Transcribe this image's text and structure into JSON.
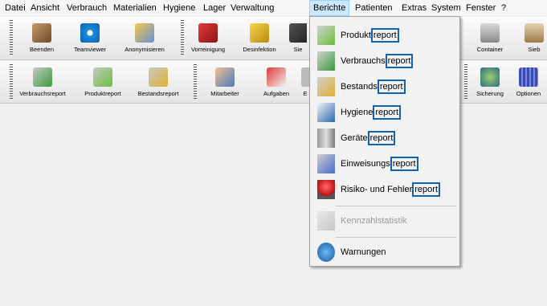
{
  "menubar": [
    "Datei",
    "Ansicht",
    "Verbrauch",
    "Materialien",
    "Hygiene",
    "Lager",
    "Verwaltung",
    "Berichte",
    "Patienten",
    "Extras",
    "System",
    "Fenster",
    "?"
  ],
  "toolbar1": [
    "Beenden",
    "Teamviewer",
    "Anonymisieren",
    "Vorreinigung",
    "Desinfektion",
    "Sie",
    "Container",
    "Sieb"
  ],
  "toolbar2": [
    "Verbrauchsreport",
    "Produktreport",
    "Bestandsreport",
    "Mitarbeiter",
    "Aufgaben",
    "E",
    "Sicherung",
    "Optionen"
  ],
  "berichte_menu": [
    {
      "prefix": "Produkt",
      "highlight": "report",
      "icon": "product-report-icon"
    },
    {
      "prefix": "Verbrauchs",
      "highlight": "report",
      "icon": "usage-report-icon"
    },
    {
      "prefix": "Bestands",
      "highlight": "report",
      "icon": "stock-report-icon"
    },
    {
      "prefix": "Hygiene",
      "highlight": "report",
      "icon": "hygiene-report-icon"
    },
    {
      "prefix": "Geräte",
      "highlight": "report",
      "icon": "device-report-icon"
    },
    {
      "prefix": "Einweisungs",
      "highlight": "report",
      "icon": "instruction-report-icon"
    },
    {
      "prefix": "Risiko- und Fehler",
      "highlight": "report",
      "icon": "risk-report-icon"
    },
    {
      "prefix": "Kennzahlstatistik",
      "highlight": "",
      "icon": "statistics-icon",
      "disabled": true
    },
    {
      "prefix": "Warnungen",
      "highlight": "",
      "icon": "warning-icon"
    }
  ]
}
